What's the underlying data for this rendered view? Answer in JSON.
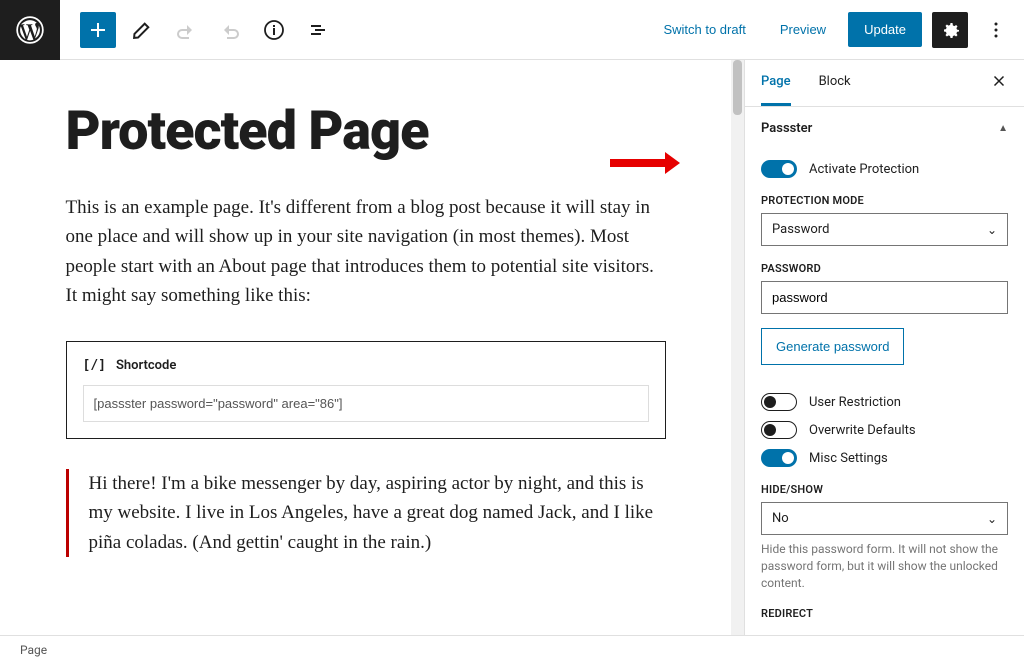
{
  "topbar": {
    "switch_to_draft": "Switch to draft",
    "preview": "Preview",
    "update": "Update"
  },
  "editor": {
    "title": "Protected Page",
    "paragraph1": "This is an example page. It's different from a blog post because it will stay in one place and will show up in your site navigation (in most themes). Most people start with an About page that introduces them to potential site visitors. It might say something like this:",
    "shortcode_label": "Shortcode",
    "shortcode_value": "[passster password=\"password\" area=\"86\"]",
    "quote": "Hi there! I'm a bike messenger by day, aspiring actor by night, and this is my website. I live in Los Angeles, have a great dog named Jack, and I like piña coladas. (And gettin' caught in the rain.)"
  },
  "sidebar": {
    "tabs": {
      "page": "Page",
      "block": "Block"
    },
    "panel_title": "Passster",
    "activate": "Activate Protection",
    "mode_label": "PROTECTION MODE",
    "mode_value": "Password",
    "password_label": "PASSWORD",
    "password_value": "password",
    "generate": "Generate password",
    "user_restriction": "User Restriction",
    "overwrite_defaults": "Overwrite Defaults",
    "misc_settings": "Misc Settings",
    "hideshow_label": "HIDE/SHOW",
    "hideshow_value": "No",
    "hideshow_help": "Hide this password form. It will not show the password form, but it will show the unlocked content.",
    "redirect_label": "REDIRECT"
  },
  "statusbar": {
    "breadcrumb": "Page"
  }
}
